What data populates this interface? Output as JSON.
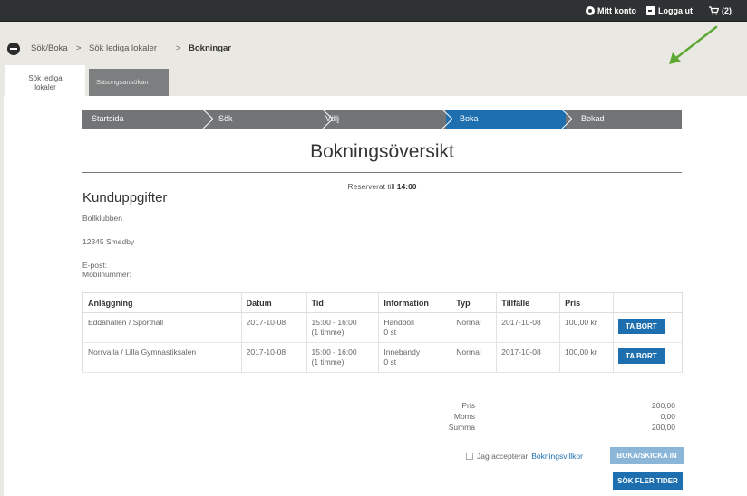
{
  "topbar": {
    "account_label": "Mitt konto",
    "logout_label": "Logga ut",
    "cart_label": "(2)"
  },
  "breadcrumb": {
    "items": [
      "Sök/Boka",
      "Sök lediga lokaler",
      "Bokningar"
    ],
    "separator": ">"
  },
  "tabs": {
    "active_line1": "Sök lediga",
    "active_line2": "lokaler",
    "inactive": "Säsongsansökan"
  },
  "steps": [
    "Startsida",
    "Sök",
    "Välj",
    "Boka",
    "Bokad"
  ],
  "steps_active_index": 3,
  "page": {
    "title": "Bokningsöversikt",
    "reserved_prefix": "Reserverat till",
    "reserved_time": "14:00"
  },
  "customer": {
    "heading": "Kunduppgifter",
    "name": "Bollklubben",
    "address": "12345 Smedby",
    "email_label": "E-post:",
    "mobile_label": "Mobilnummer:"
  },
  "table": {
    "headers": [
      "Anläggning",
      "Datum",
      "Tid",
      "Information",
      "Typ",
      "Tillfälle",
      "Pris",
      ""
    ],
    "rows": [
      {
        "facility": "Eddahallen / Sporthall",
        "date": "2017-10-08",
        "time": "15:00 - 16:00",
        "duration": "(1 timme)",
        "info": "Handboll",
        "count": "0 st",
        "type": "Normal",
        "occasion": "2017-10-08",
        "price": "100,00 kr",
        "action": "TA BORT"
      },
      {
        "facility": "Norrvalla / Lilla Gymnastiksalen",
        "date": "2017-10-08",
        "time": "15:00 - 16:00",
        "duration": "(1 timme)",
        "info": "Innebandy",
        "count": "0 st",
        "type": "Normal",
        "occasion": "2017-10-08",
        "price": "100,00 kr",
        "action": "TA BORT"
      }
    ]
  },
  "summary": {
    "price_label": "Pris",
    "price_value": "200,00",
    "vat_label": "Moms",
    "vat_value": "0,00",
    "total_label": "Summa",
    "total_value": "200,00"
  },
  "actions": {
    "accept_text": "Jag accepterar",
    "terms_link": "Bokningsvillkor",
    "book_button": "BOKA/SKICKA IN",
    "more_button": "SÖK FLER TIDER"
  },
  "colors": {
    "topbar": "#2f3233",
    "accent": "#1d6fb0",
    "annotation_arrow": "#5da832"
  },
  "icons": {
    "account": "gear-icon",
    "logout": "logout-icon",
    "cart": "cart-icon",
    "back": "back-circle-icon"
  }
}
